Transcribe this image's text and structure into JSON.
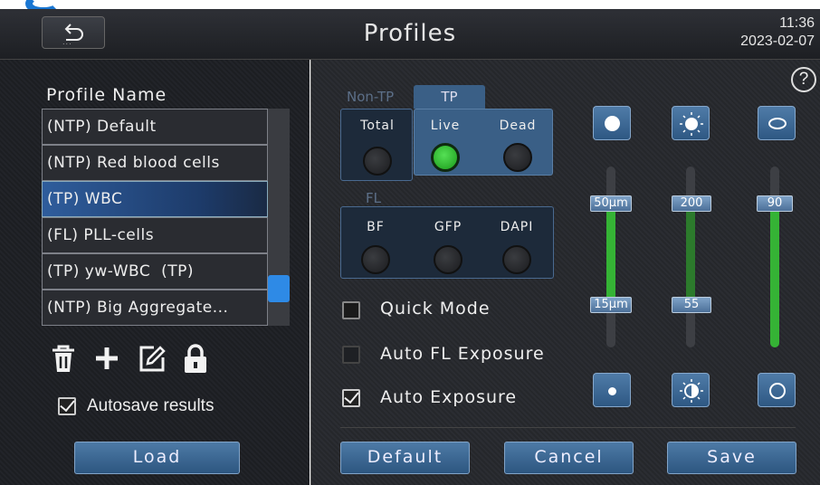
{
  "header": {
    "back_icon": "back-arrow-icon",
    "back_dots": "...",
    "title": "Profiles",
    "time": "11:36",
    "date": "2023-02-07"
  },
  "left": {
    "profile_name_label": "Profile Name",
    "profiles": [
      "(NTP) Default",
      "(NTP) Red blood cells",
      "(TP) WBC",
      "(FL) PLL-cells",
      "(TP) yw-WBC  (TP)",
      "(NTP) Big Aggregate..."
    ],
    "selected_index": 2,
    "tools": [
      "trash-icon",
      "plus-icon",
      "edit-icon",
      "lock-icon"
    ],
    "autosave_label": "Autosave results",
    "autosave_checked": true,
    "load_label": "Load"
  },
  "right": {
    "help_label": "?",
    "non_tp_tab": "Non-TP",
    "tp_tab": "TP",
    "total_label": "Total",
    "live_label": "Live",
    "dead_label": "Dead",
    "fl_label": "FL",
    "bf_label": "BF",
    "gfp_label": "GFP",
    "dapi_label": "DAPI",
    "quick_mode_label": "Quick Mode",
    "auto_fl_label": "Auto FL Exposure",
    "auto_exposure_label": "Auto Exposure",
    "auto_exposure_checked": true,
    "size_max": "50μm",
    "size_min": "15μm",
    "brightness_max": "200",
    "brightness_min": "55",
    "roundness": "90",
    "default_label": "Default",
    "cancel_label": "Cancel",
    "save_label": "Save"
  },
  "colors": {
    "accent_blue": "#2e8ae6",
    "button_blue": "#3b6893",
    "led_green": "#35b335"
  }
}
